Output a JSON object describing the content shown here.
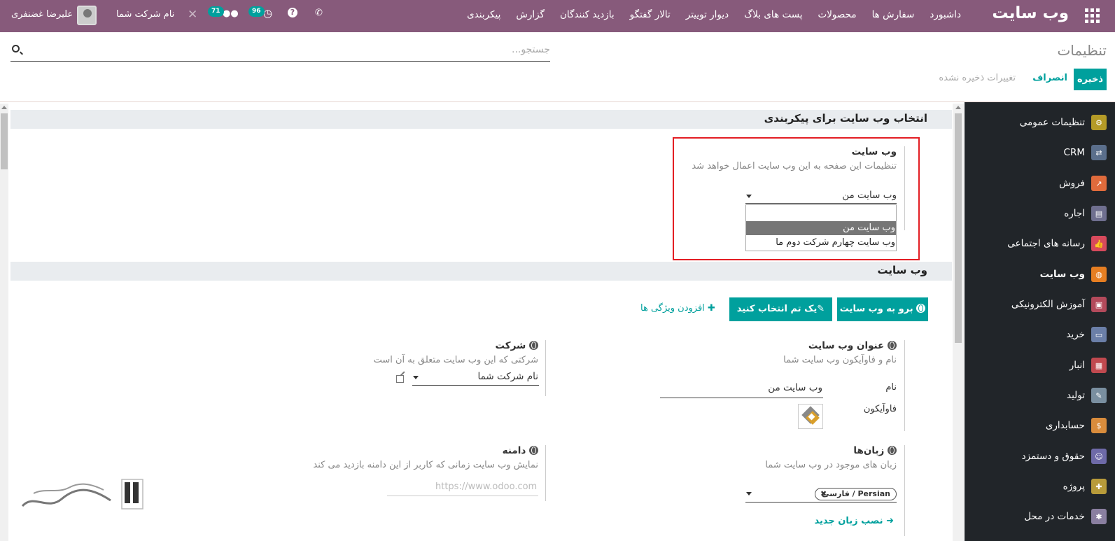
{
  "navbar": {
    "brand": "وب سایت",
    "menu": [
      "داشبورد",
      "سفارش ها",
      "محصولات",
      "پست های بلاگ",
      "دیوار توییتر",
      "تالار گفتگو",
      "بازدید کنندگان",
      "گزارش",
      "پیکربندی"
    ],
    "user_name": "علیرضا غضنفری",
    "company_name": "نام شرکت شما",
    "messages_count": "71",
    "activities_count": "96"
  },
  "control_panel": {
    "title": "تنظیمات",
    "search_placeholder": "جستجو...",
    "save_label": "ذخیره",
    "discard_label": "انصراف",
    "unsaved_label": "تغییرات ذخیره نشده"
  },
  "sidebar": {
    "items": [
      {
        "label": "تنظیمات عمومی",
        "icon": "gear-icon",
        "color": "#b59b27"
      },
      {
        "label": "CRM",
        "icon": "handshake-icon",
        "color": "#5b6f8c"
      },
      {
        "label": "فروش",
        "icon": "chart-icon",
        "color": "#e06b3c"
      },
      {
        "label": "اجاره",
        "icon": "rental-icon",
        "color": "#6f6f8f"
      },
      {
        "label": "رسانه های اجتماعی",
        "icon": "thumbs-up-icon",
        "color": "#d84a5c"
      },
      {
        "label": "وب سایت",
        "icon": "globe-icon",
        "color": "#e67e22"
      },
      {
        "label": "آموزش الکترونیکی",
        "icon": "elearning-icon",
        "color": "#b34a5b"
      },
      {
        "label": "خرید",
        "icon": "credit-card-icon",
        "color": "#6b7fa8"
      },
      {
        "label": "انبار",
        "icon": "boxes-icon",
        "color": "#c0494f"
      },
      {
        "label": "تولید",
        "icon": "wrench-icon",
        "color": "#7a8fa0"
      },
      {
        "label": "حسابداری",
        "icon": "invoice-icon",
        "color": "#d98c3c"
      },
      {
        "label": "حقوق و دستمزد",
        "icon": "payroll-icon",
        "color": "#6e6aa8"
      },
      {
        "label": "پروژه",
        "icon": "puzzle-icon",
        "color": "#b89b3a"
      },
      {
        "label": "خدمات در محل",
        "icon": "field-service-icon",
        "color": "#8a7fa0"
      }
    ]
  },
  "section_config": {
    "title": "انتخاب وب سایت برای پیکربندی",
    "field_label": "وب سایت",
    "field_help": "تنظیمات این صفحه به این وب سایت اعمال خواهد شد",
    "selected_value": "وب سایت من",
    "options": [
      "",
      "وب سایت من",
      "وب سایت چهارم شرکت دوم ما"
    ]
  },
  "section_website": {
    "title": "وب سایت",
    "go_to_website": "برو به وب سایت",
    "pick_theme": "یک تم انتخاب کنید",
    "add_features": "افزودن ویژگی ها",
    "website_title": {
      "label": "عنوان وب سایت",
      "help": "نام و فاوآیکون وب سایت شما",
      "name_label": "نام",
      "name_value": "وب سایت من",
      "favicon_label": "فاوآیکون"
    },
    "company": {
      "label": "شرکت",
      "help": "شرکتی که این وب سایت متعلق به آن است",
      "value": "نام شرکت شما"
    },
    "languages": {
      "label": "زبان‌ها",
      "help": "زبان های موجود در وب سایت شما",
      "tag": "Persian / فارسی",
      "install_label": "نصب زبان جدید"
    },
    "domain": {
      "label": "دامنه",
      "help": "نمایش وب سایت زمانی که کاربر از این دامنه بازدید می کند",
      "placeholder": "https://www.odoo.com"
    }
  },
  "colors": {
    "brand": "#875a7b",
    "accent": "#00a09d",
    "highlight": "#e31e24"
  }
}
